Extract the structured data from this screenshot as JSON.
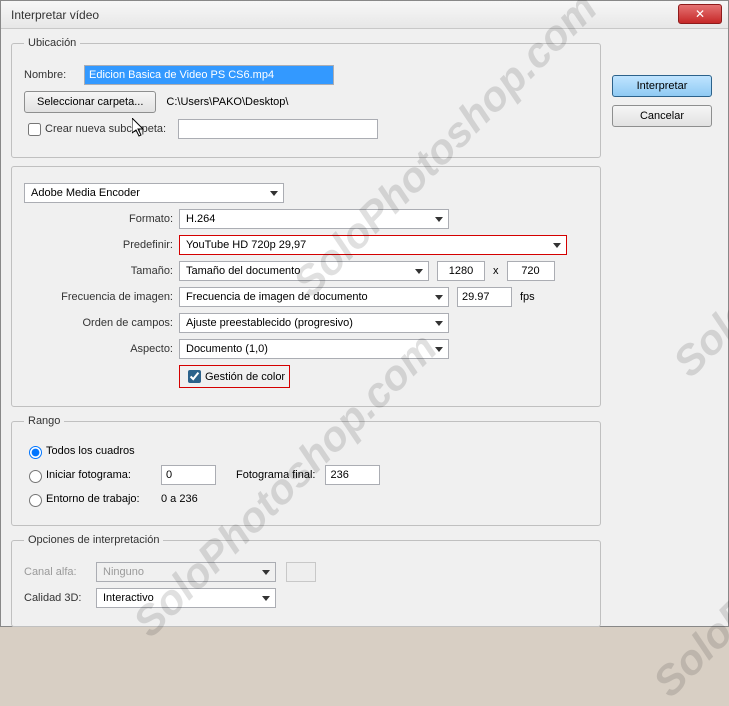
{
  "window": {
    "title": "Interpretar vídeo"
  },
  "actions": {
    "ok": "Interpretar",
    "cancel": "Cancelar"
  },
  "location": {
    "legend": "Ubicación",
    "name_label": "Nombre:",
    "name_value": "Edicion Basica de Video PS CS6.mp4",
    "select_folder_btn": "Seleccionar carpeta...",
    "folder_path": "C:\\Users\\PAKO\\Desktop\\",
    "new_subfolder_label": "Crear nueva subcarpeta:",
    "new_subfolder_checked": false,
    "new_subfolder_value": ""
  },
  "encoder": {
    "engine": "Adobe Media Encoder",
    "format_label": "Formato:",
    "format_value": "H.264",
    "preset_label": "Predefinir:",
    "preset_value": "YouTube HD 720p 29,97",
    "size_label": "Tamaño:",
    "size_mode": "Tamaño del documento",
    "width": "1280",
    "x": "x",
    "height": "720",
    "fps_label": "Frecuencia de imagen:",
    "fps_mode": "Frecuencia de imagen de documento",
    "fps_value": "29.97",
    "fps_unit": "fps",
    "field_order_label": "Orden de campos:",
    "field_order_value": "Ajuste preestablecido (progresivo)",
    "aspect_label": "Aspecto:",
    "aspect_value": "Documento (1,0)",
    "color_mgmt_label": "Gestión de color",
    "color_mgmt_checked": true
  },
  "range": {
    "legend": "Rango",
    "all_label": "Todos los cuadros",
    "start_label": "Iniciar fotograma:",
    "start_value": "0",
    "end_label": "Fotograma final:",
    "end_value": "236",
    "workarea_label": "Entorno de trabajo:",
    "workarea_value": "0 a 236",
    "selected": "all"
  },
  "render": {
    "legend": "Opciones de interpretación",
    "alpha_label": "Canal alfa:",
    "alpha_value": "Ninguno",
    "quality_label": "Calidad 3D:",
    "quality_value": "Interactivo"
  },
  "watermark": "SoloPhotoshop.com"
}
